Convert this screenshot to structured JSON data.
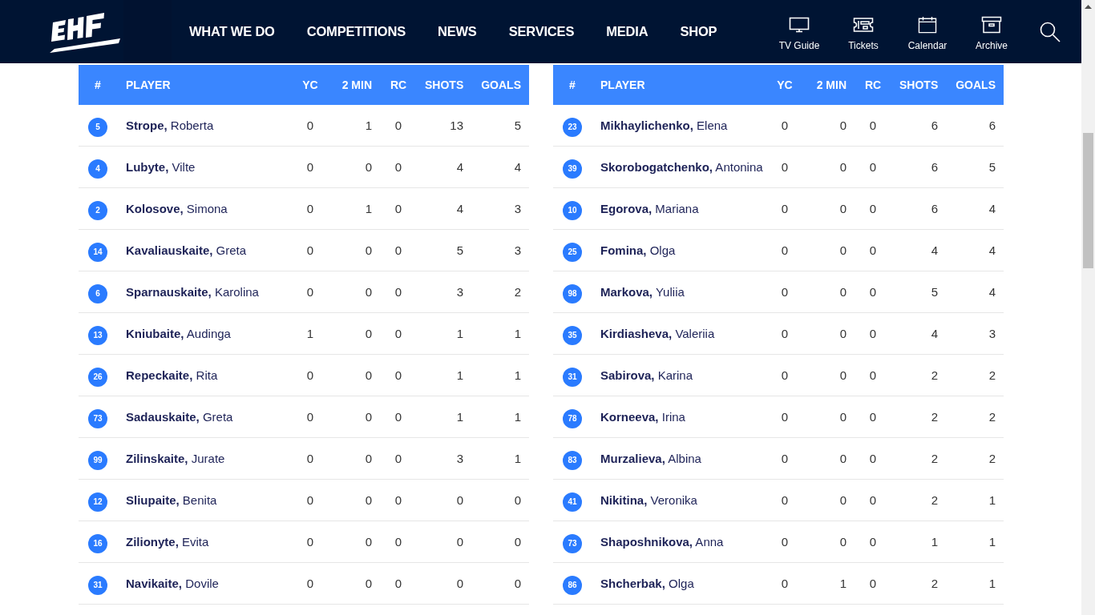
{
  "header": {
    "nav": [
      "WHAT WE DO",
      "COMPETITIONS",
      "NEWS",
      "SERVICES",
      "MEDIA",
      "SHOP"
    ],
    "quick_links": [
      {
        "kind": "tv",
        "label": "TV Guide"
      },
      {
        "kind": "ticket",
        "label": "Tickets"
      },
      {
        "kind": "calendar",
        "label": "Calendar"
      },
      {
        "kind": "archive",
        "label": "Archive"
      }
    ]
  },
  "tables": [
    {
      "columns": [
        "#",
        "PLAYER",
        "YC",
        "2 MIN",
        "RC",
        "SHOTS",
        "GOALS"
      ],
      "rows": [
        {
          "number": "5",
          "name": "**Strope,** Roberta",
          "stats": [
            "0",
            "1",
            "0",
            "13",
            "5"
          ]
        },
        {
          "number": "4",
          "name": "**Lubyte,** Vilte",
          "stats": [
            "0",
            "0",
            "0",
            "4",
            "4"
          ]
        },
        {
          "number": "2",
          "name": "**Kolosove,** Simona",
          "stats": [
            "0",
            "1",
            "0",
            "4",
            "3"
          ]
        },
        {
          "number": "14",
          "name": "**Kavaliauskaite,** Greta",
          "stats": [
            "0",
            "0",
            "0",
            "5",
            "3"
          ]
        },
        {
          "number": "6",
          "name": "**Sparnauskaite,** Karolina",
          "stats": [
            "0",
            "0",
            "0",
            "3",
            "2"
          ]
        },
        {
          "number": "13",
          "name": "**Kniubaite,** Audinga",
          "stats": [
            "1",
            "0",
            "0",
            "1",
            "1"
          ]
        },
        {
          "number": "26",
          "name": "**Repeckaite,** Rita",
          "stats": [
            "0",
            "0",
            "0",
            "1",
            "1"
          ]
        },
        {
          "number": "73",
          "name": "**Sadauskaite,** Greta",
          "stats": [
            "0",
            "0",
            "0",
            "1",
            "1"
          ]
        },
        {
          "number": "99",
          "name": "**Zilinskaite,** Jurate",
          "stats": [
            "0",
            "0",
            "0",
            "3",
            "1"
          ]
        },
        {
          "number": "12",
          "name": "**Sliupaite,** Benita",
          "stats": [
            "0",
            "0",
            "0",
            "0",
            "0"
          ]
        },
        {
          "number": "16",
          "name": "**Zilionyte,** Evita",
          "stats": [
            "0",
            "0",
            "0",
            "0",
            "0"
          ]
        },
        {
          "number": "31",
          "name": "**Navikaite,** Dovile",
          "stats": [
            "0",
            "0",
            "0",
            "0",
            "0"
          ]
        }
      ]
    },
    {
      "columns": [
        "#",
        "PLAYER",
        "YC",
        "2 MIN",
        "RC",
        "SHOTS",
        "GOALS"
      ],
      "rows": [
        {
          "number": "23",
          "name": "**Mikhaylichenko,** Elena",
          "stats": [
            "0",
            "0",
            "0",
            "6",
            "6"
          ]
        },
        {
          "number": "39",
          "name": "**Skorobogatchenko,** Antonina",
          "stats": [
            "0",
            "0",
            "0",
            "6",
            "5"
          ]
        },
        {
          "number": "10",
          "name": "**Egorova,** Mariana",
          "stats": [
            "0",
            "0",
            "0",
            "6",
            "4"
          ]
        },
        {
          "number": "25",
          "name": "**Fomina,** Olga",
          "stats": [
            "0",
            "0",
            "0",
            "4",
            "4"
          ]
        },
        {
          "number": "98",
          "name": "**Markova,** Yuliia",
          "stats": [
            "0",
            "0",
            "0",
            "5",
            "4"
          ]
        },
        {
          "number": "35",
          "name": "**Kirdiasheva,** Valeriia",
          "stats": [
            "0",
            "0",
            "0",
            "4",
            "3"
          ]
        },
        {
          "number": "31",
          "name": "**Sabirova,** Karina",
          "stats": [
            "0",
            "0",
            "0",
            "2",
            "2"
          ]
        },
        {
          "number": "78",
          "name": "**Korneeva,** Irina",
          "stats": [
            "0",
            "0",
            "0",
            "2",
            "2"
          ]
        },
        {
          "number": "83",
          "name": "**Murzalieva,** Albina",
          "stats": [
            "0",
            "0",
            "0",
            "2",
            "2"
          ]
        },
        {
          "number": "41",
          "name": "**Nikitina,** Veronika",
          "stats": [
            "0",
            "0",
            "0",
            "2",
            "1"
          ]
        },
        {
          "number": "73",
          "name": "**Shaposhnikova,** Anna",
          "stats": [
            "0",
            "0",
            "0",
            "1",
            "1"
          ]
        },
        {
          "number": "86",
          "name": "**Shcherbak,** Olga",
          "stats": [
            "0",
            "1",
            "0",
            "2",
            "1"
          ]
        }
      ]
    }
  ]
}
